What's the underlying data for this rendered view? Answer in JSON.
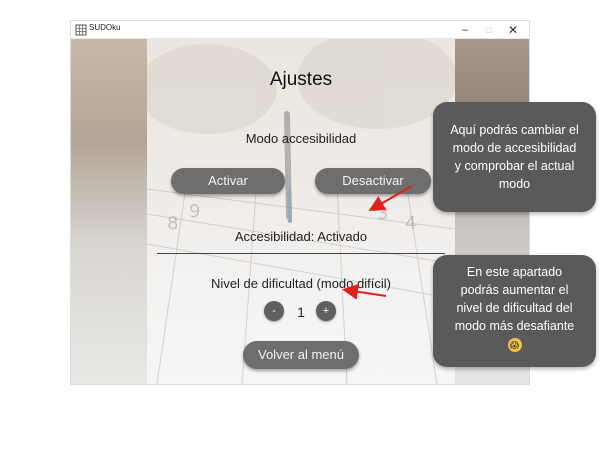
{
  "window": {
    "title": "SUDOku",
    "minimize": "–",
    "maximize": "□",
    "close": "✕"
  },
  "settings": {
    "title": "Ajustes",
    "accessibility_mode_label": "Modo accesibilidad",
    "activate_label": "Activar",
    "deactivate_label": "Desactivar",
    "accessibility_status": "Accesibilidad: Activado",
    "difficulty_label": "Nivel de dificultad (modo difícil)",
    "decrease_label": "-",
    "level_value": "1",
    "increase_label": "+",
    "back_label": "Volver al menú"
  },
  "background_digits": [
    "9",
    "8",
    "3",
    "4"
  ],
  "tooltips": {
    "accessibility": [
      "Aquí podrás cambiar el",
      "modo de accesibilidad",
      "y comprobar el actual",
      "modo"
    ],
    "difficulty": [
      "En este apartado",
      "podrás aumentar el",
      "nivel de dificultad del",
      "modo más desafiante"
    ],
    "difficulty_emoji": "😱"
  },
  "colors": {
    "button": "#6e6e6e",
    "tooltip": "#5a5a5a",
    "arrow": "#e0201b"
  }
}
